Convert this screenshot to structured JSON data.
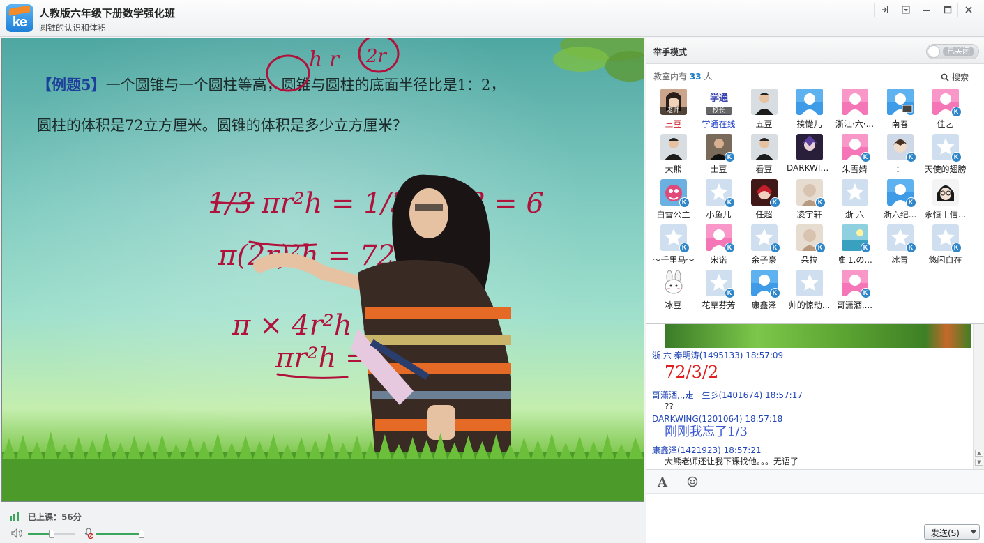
{
  "window": {
    "logo_text": "ke",
    "title": "人教版六年级下册数学强化班",
    "subtitle": "圆锥的认识和体积",
    "buttons": [
      "pin",
      "dropdown",
      "minimize",
      "maximize",
      "close"
    ]
  },
  "video": {
    "problem_label": "【例题5】",
    "problem_text": "一个圆锥与一个圆柱等高，圆锥与圆柱的底面半径比是1：2，圆柱的体积是72立方厘米。圆锥的体积是多少立方厘米？",
    "handwriting": {
      "h_r": "h r",
      "two_r": "2r",
      "line1": "1/3 πr²h = 1/3 × 18 = 6",
      "line2": "π(2r)²h = 72",
      "line3": "π × 4r²h = 72",
      "line4": "πr²h = 18"
    }
  },
  "status": {
    "class_time": "已上课：56分",
    "volume_level": 0.5,
    "mic_level": 0.95,
    "mic_muted": true
  },
  "right_panel": {
    "raise_hand": {
      "title": "举手模式",
      "toggle_label": "已关闭"
    },
    "count_prefix": "教室内有",
    "count": "33",
    "count_suffix": "人",
    "search_label": "搜索",
    "members": [
      {
        "name": "三豆",
        "tag": "老师",
        "style": "red",
        "avatar": "photo-woman",
        "k": false
      },
      {
        "name": "学通在线",
        "tag": "校长",
        "style": "blue",
        "avatar": "logo-xuetong",
        "k": false
      },
      {
        "name": "五豆",
        "tag": "",
        "style": "",
        "avatar": "photo-man",
        "k": false
      },
      {
        "name": "揍憷儿",
        "tag": "",
        "style": "",
        "avatar": "default-blue",
        "k": false
      },
      {
        "name": "浙江·六·...",
        "tag": "",
        "style": "",
        "avatar": "default-pink",
        "k": false
      },
      {
        "name": "南春",
        "tag": "",
        "style": "",
        "avatar": "default-blue-screen",
        "k": false
      },
      {
        "name": "佳艺",
        "tag": "",
        "style": "",
        "avatar": "default-pink",
        "k": true
      },
      {
        "name": "大熊",
        "tag": "",
        "style": "",
        "avatar": "photo-man",
        "k": false
      },
      {
        "name": "土豆",
        "tag": "",
        "style": "",
        "avatar": "photo-man-dark",
        "k": true
      },
      {
        "name": "看豆",
        "tag": "",
        "style": "",
        "avatar": "photo-man",
        "k": false
      },
      {
        "name": "DARKWING",
        "tag": "",
        "style": "",
        "avatar": "photo-anime-dark",
        "k": false
      },
      {
        "name": "朱雪婧",
        "tag": "",
        "style": "",
        "avatar": "default-pink",
        "k": true
      },
      {
        "name": "：",
        "tag": "",
        "style": "",
        "avatar": "photo-anime",
        "k": true
      },
      {
        "name": "天使的翅膀",
        "tag": "",
        "style": "",
        "avatar": "default-star",
        "k": true
      },
      {
        "name": "白雪公主",
        "tag": "",
        "style": "",
        "avatar": "photo-cartoon",
        "k": true
      },
      {
        "name": "小鱼儿",
        "tag": "",
        "style": "",
        "avatar": "default-star",
        "k": true
      },
      {
        "name": "任超",
        "tag": "",
        "style": "",
        "avatar": "photo-anime-red",
        "k": true
      },
      {
        "name": "凌宇轩",
        "tag": "",
        "style": "",
        "avatar": "photo-sketch",
        "k": true
      },
      {
        "name": "浙 六",
        "tag": "",
        "style": "",
        "avatar": "default-star",
        "k": false
      },
      {
        "name": "浙六纪...",
        "tag": "",
        "style": "",
        "avatar": "default-blue",
        "k": true
      },
      {
        "name": "永恒丨信...",
        "tag": "",
        "style": "",
        "avatar": "photo-anime-glasses",
        "k": false
      },
      {
        "name": "～千里马～",
        "tag": "",
        "style": "",
        "avatar": "default-star",
        "k": true
      },
      {
        "name": "宋诺",
        "tag": "",
        "style": "",
        "avatar": "default-pink",
        "k": true
      },
      {
        "name": "余子豪",
        "tag": "",
        "style": "",
        "avatar": "default-star",
        "k": true
      },
      {
        "name": "朵拉",
        "tag": "",
        "style": "",
        "avatar": "photo-sketch",
        "k": true
      },
      {
        "name": "唯 1.の...",
        "tag": "",
        "style": "",
        "avatar": "photo-sea",
        "k": true
      },
      {
        "name": "冰青",
        "tag": "",
        "style": "",
        "avatar": "default-star",
        "k": true
      },
      {
        "name": "悠闲自在",
        "tag": "",
        "style": "",
        "avatar": "default-star",
        "k": true
      },
      {
        "name": "冰豆",
        "tag": "",
        "style": "",
        "avatar": "photo-rabbit",
        "k": false
      },
      {
        "name": "花草芬芳",
        "tag": "",
        "style": "",
        "avatar": "default-star",
        "k": true
      },
      {
        "name": "康鑫泽",
        "tag": "",
        "style": "",
        "avatar": "default-blue",
        "k": true
      },
      {
        "name": "帅的惊动...",
        "tag": "",
        "style": "",
        "avatar": "default-star",
        "k": false
      },
      {
        "name": "哥潇洒,...",
        "tag": "",
        "style": "",
        "avatar": "default-pink",
        "k": true
      }
    ],
    "chat": [
      {
        "head": "浙  六   秦明涛(1495133) 18:57:09",
        "text": "72/3/2",
        "size": "big",
        "color": "#e0201f"
      },
      {
        "head": "哥潇洒,,,走一生彡(1401674) 18:57:17",
        "text": "??",
        "size": "small",
        "color": "#222222"
      },
      {
        "head": "DARKWING(1201064) 18:57:18",
        "text": "刚刚我忘了1/3",
        "size": "mid",
        "color": "#3a56d6"
      },
      {
        "head": "康鑫泽(1421923) 18:57:21",
        "text": "大熊老师还让我下课找他。。。无语了",
        "size": "small",
        "color": "#222222"
      }
    ],
    "send_label": "发送(S)"
  }
}
